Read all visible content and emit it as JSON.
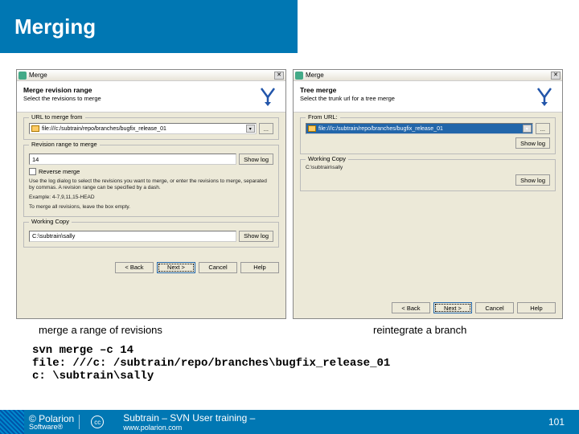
{
  "header": {
    "title": "Merging"
  },
  "dlgLeft": {
    "winTitle": "Merge",
    "captionBold": "Merge revision range",
    "captionSub": "Select the revisions to merge",
    "grpUrl": "URL to merge from",
    "url": "file:///c:/subtrain/repo/branches/bugfix_release_01",
    "browse": "...",
    "grpRev": "Revision range to merge",
    "rev": "14",
    "showlog": "Show log",
    "reverse": "Reverse merge",
    "help1": "Use the log dialog to select the revisions you want to merge, or enter the revisions to merge, separated by commas. A revision range can be specified by a dash.",
    "help2": "Example: 4-7,9,11,15-HEAD",
    "help3": "To merge all revisions, leave the box empty.",
    "grpWc": "Working Copy",
    "wc": "C:\\subtrain\\sally",
    "back": "< Back",
    "next": "Next >",
    "cancel": "Cancel",
    "helpBtn": "Help"
  },
  "dlgRight": {
    "winTitle": "Merge",
    "captionBold": "Tree merge",
    "captionSub": "Select the trunk url for a tree merge",
    "grpUrl": "From URL:",
    "url": "file:///c:/subtrain/repo/branches/bugfix_release_01",
    "browse": "...",
    "showlog": "Show log",
    "grpWc": "Working Copy",
    "wc": "C:\\subtrain\\sally",
    "back": "< Back",
    "next": "Next >",
    "cancel": "Cancel",
    "helpBtn": "Help"
  },
  "captions": {
    "left": "merge a range of revisions",
    "right": "reintegrate a branch"
  },
  "cmd": {
    "l1": "svn merge –c 14",
    "l2": "file: ///c: /subtrain/repo/branches\\bugfix_release_01",
    "l3": "c: \\subtrain\\sally"
  },
  "footer": {
    "copyright": "© Polarion",
    "sub": "Software®",
    "cc": "cc",
    "mid": "Subtrain – SVN User training –",
    "midsub": "www.polarion.com",
    "page": "101"
  }
}
